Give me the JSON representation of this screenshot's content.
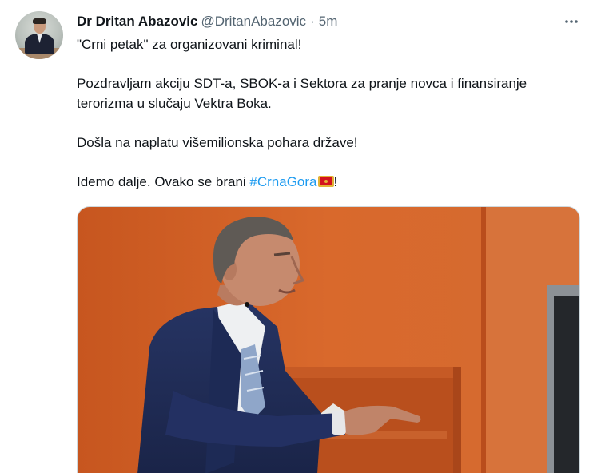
{
  "tweet": {
    "author_name": "Dr Dritan Abazovic",
    "author_handle": "@DritanAbazovic",
    "separator": "·",
    "timestamp": "5m",
    "lines": [
      "\"Crni petak\" za organizovani kriminal!",
      "Pozdravljam akciju SDT-a, SBOK-a i Sektora za pranje novca i finansiranje terorizma u slučaju Vektra Boka.",
      "Došla na naplatu višemilionska pohara države!",
      "Idemo dalje. Ovako se brani "
    ],
    "hashtag": "#CrnaGora",
    "trailing": "!",
    "icons": {
      "more": "more-horizontal-icon",
      "flag": "montenegro-flag-icon"
    },
    "colors": {
      "link": "#1d9bf0",
      "secondary_text": "#536471",
      "primary_text": "#0f1419"
    }
  }
}
